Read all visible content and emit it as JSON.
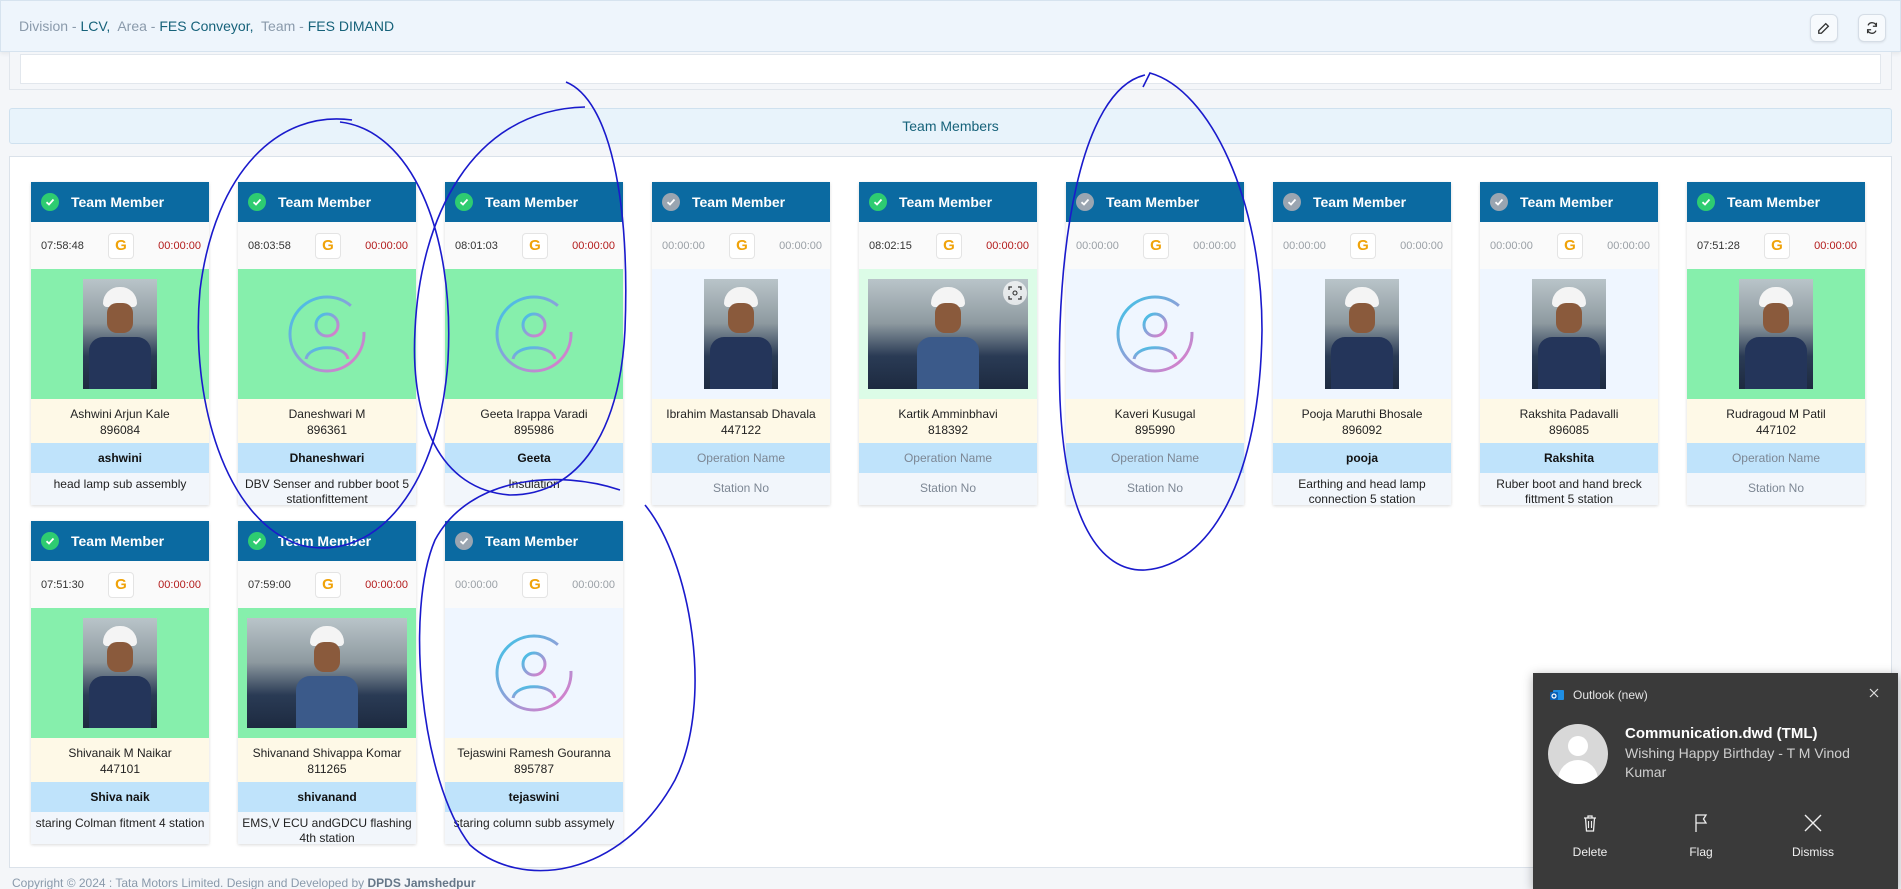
{
  "breadcrumb": {
    "division_label": "Division -",
    "division_value": "LCV,",
    "area_label": "Area -",
    "area_value": "FES Conveyor,",
    "team_label": "Team -",
    "team_value": "FES DIMAND"
  },
  "toolbar": {
    "edit_icon": "edit-icon",
    "refresh_icon": "refresh-icon"
  },
  "section_title": "Team Members",
  "cards": [
    {
      "header": "Team Member",
      "checked": true,
      "in_time": "07:58:48",
      "badge": "G",
      "out_time": "00:00:00",
      "photo": "photo",
      "photo_bg": "green",
      "name": "Ashwini Arjun Kale",
      "id": "896084",
      "operation": "ashwini",
      "station": "head lamp sub assembly"
    },
    {
      "header": "Team Member",
      "checked": true,
      "in_time": "08:03:58",
      "badge": "G",
      "out_time": "00:00:00",
      "photo": "avatar",
      "photo_bg": "green",
      "name": "Daneshwari M",
      "id": "896361",
      "operation": "Dhaneshwari",
      "station": "DBV Senser and rubber boot 5 stationfittement"
    },
    {
      "header": "Team Member",
      "checked": true,
      "in_time": "08:01:03",
      "badge": "G",
      "out_time": "00:00:00",
      "photo": "avatar",
      "photo_bg": "green",
      "name": "Geeta Irappa Varadi",
      "id": "895986",
      "operation": "Geeta",
      "station": "Insulation"
    },
    {
      "header": "Team Member",
      "checked": false,
      "in_time": "00:00:00",
      "badge": "G",
      "out_time": "00:00:00",
      "photo": "photo",
      "photo_bg": "light",
      "name": "Ibrahim Mastansab Dhavala",
      "id": "447122",
      "operation": "Operation Name",
      "station": "Station No"
    },
    {
      "header": "Team Member",
      "checked": true,
      "in_time": "08:02:15",
      "badge": "G",
      "out_time": "00:00:00",
      "photo": "wide",
      "photo_bg": "lightgreen",
      "name": "Kartik Amminbhavi",
      "id": "818392",
      "operation": "Operation Name",
      "station": "Station No"
    },
    {
      "header": "Team Member",
      "checked": false,
      "in_time": "00:00:00",
      "badge": "G",
      "out_time": "00:00:00",
      "photo": "avatar",
      "photo_bg": "light",
      "name": "Kaveri Kusugal",
      "id": "895990",
      "operation": "Operation Name",
      "station": "Station No"
    },
    {
      "header": "Team Member",
      "checked": false,
      "in_time": "00:00:00",
      "badge": "G",
      "out_time": "00:00:00",
      "photo": "photo",
      "photo_bg": "light",
      "name": "Pooja Maruthi Bhosale",
      "id": "896092",
      "operation": "pooja",
      "station": "Earthing and head lamp connection 5 station"
    },
    {
      "header": "Team Member",
      "checked": false,
      "in_time": "00:00:00",
      "badge": "G",
      "out_time": "00:00:00",
      "photo": "photo",
      "photo_bg": "light",
      "name": "Rakshita Padavalli",
      "id": "896085",
      "operation": "Rakshita",
      "station": "Ruber boot and hand breck fittment 5 station"
    },
    {
      "header": "Team Member",
      "checked": true,
      "in_time": "07:51:28",
      "badge": "G",
      "out_time": "00:00:00",
      "photo": "photo",
      "photo_bg": "green",
      "name": "Rudragoud M Patil",
      "id": "447102",
      "operation": "Operation Name",
      "station": "Station No"
    },
    {
      "header": "Team Member",
      "checked": true,
      "in_time": "07:51:30",
      "badge": "G",
      "out_time": "00:00:00",
      "photo": "photo",
      "photo_bg": "green",
      "name": "Shivanaik M Naikar",
      "id": "447101",
      "operation": "Shiva naik",
      "station": "staring Colman fitment 4 station"
    },
    {
      "header": "Team Member",
      "checked": true,
      "in_time": "07:59:00",
      "badge": "G",
      "out_time": "00:00:00",
      "photo": "wide",
      "photo_bg": "green",
      "name": "Shivanand Shivappa Komar",
      "id": "811265",
      "operation": "shivanand",
      "station": "EMS,V ECU andGDCU flashing 4th station"
    },
    {
      "header": "Team Member",
      "checked": false,
      "in_time": "00:00:00",
      "badge": "G",
      "out_time": "00:00:00",
      "photo": "avatar",
      "photo_bg": "light",
      "name": "Tejaswini Ramesh Gouranna",
      "id": "895787",
      "operation": "tejaswini",
      "station": "staring column subb assymely"
    }
  ],
  "footer": {
    "text": "Copyright © 2024 : Tata Motors Limited.  Design and Developed by ",
    "brand": "DPDS Jamshedpur"
  },
  "notification": {
    "app": "Outlook (new)",
    "sender": "Communication.dwd (TML)",
    "message": "Wishing Happy Birthday - T M Vinod Kumar",
    "actions": [
      "Delete",
      "Flag",
      "Dismiss"
    ],
    "icons": [
      "outlook-icon",
      "close-icon",
      "trash-icon",
      "flag-icon",
      "dismiss-icon"
    ]
  },
  "colors": {
    "header_blue": "#0b6aa1",
    "check_green": "#2ecc71",
    "photo_green": "#86efac",
    "operation_blue": "#bfe3fb",
    "name_cream": "#fef9e7",
    "out_time_red": "#b31b1b",
    "badge_orange": "#f0a30a",
    "annotation_ink": "#1a1acc",
    "toast_bg": "#3a3a3a"
  }
}
